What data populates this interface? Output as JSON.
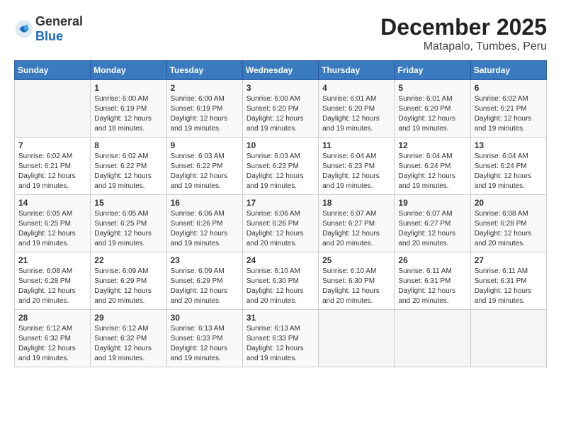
{
  "header": {
    "logo_general": "General",
    "logo_blue": "Blue",
    "title": "December 2025",
    "subtitle": "Matapalo, Tumbes, Peru"
  },
  "calendar": {
    "days_of_week": [
      "Sunday",
      "Monday",
      "Tuesday",
      "Wednesday",
      "Thursday",
      "Friday",
      "Saturday"
    ],
    "weeks": [
      [
        {
          "day": "",
          "info": ""
        },
        {
          "day": "1",
          "info": "Sunrise: 6:00 AM\nSunset: 6:19 PM\nDaylight: 12 hours\nand 18 minutes."
        },
        {
          "day": "2",
          "info": "Sunrise: 6:00 AM\nSunset: 6:19 PM\nDaylight: 12 hours\nand 19 minutes."
        },
        {
          "day": "3",
          "info": "Sunrise: 6:00 AM\nSunset: 6:20 PM\nDaylight: 12 hours\nand 19 minutes."
        },
        {
          "day": "4",
          "info": "Sunrise: 6:01 AM\nSunset: 6:20 PM\nDaylight: 12 hours\nand 19 minutes."
        },
        {
          "day": "5",
          "info": "Sunrise: 6:01 AM\nSunset: 6:20 PM\nDaylight: 12 hours\nand 19 minutes."
        },
        {
          "day": "6",
          "info": "Sunrise: 6:02 AM\nSunset: 6:21 PM\nDaylight: 12 hours\nand 19 minutes."
        }
      ],
      [
        {
          "day": "7",
          "info": "Sunrise: 6:02 AM\nSunset: 6:21 PM\nDaylight: 12 hours\nand 19 minutes."
        },
        {
          "day": "8",
          "info": "Sunrise: 6:02 AM\nSunset: 6:22 PM\nDaylight: 12 hours\nand 19 minutes."
        },
        {
          "day": "9",
          "info": "Sunrise: 6:03 AM\nSunset: 6:22 PM\nDaylight: 12 hours\nand 19 minutes."
        },
        {
          "day": "10",
          "info": "Sunrise: 6:03 AM\nSunset: 6:23 PM\nDaylight: 12 hours\nand 19 minutes."
        },
        {
          "day": "11",
          "info": "Sunrise: 6:04 AM\nSunset: 6:23 PM\nDaylight: 12 hours\nand 19 minutes."
        },
        {
          "day": "12",
          "info": "Sunrise: 6:04 AM\nSunset: 6:24 PM\nDaylight: 12 hours\nand 19 minutes."
        },
        {
          "day": "13",
          "info": "Sunrise: 6:04 AM\nSunset: 6:24 PM\nDaylight: 12 hours\nand 19 minutes."
        }
      ],
      [
        {
          "day": "14",
          "info": "Sunrise: 6:05 AM\nSunset: 6:25 PM\nDaylight: 12 hours\nand 19 minutes."
        },
        {
          "day": "15",
          "info": "Sunrise: 6:05 AM\nSunset: 6:25 PM\nDaylight: 12 hours\nand 19 minutes."
        },
        {
          "day": "16",
          "info": "Sunrise: 6:06 AM\nSunset: 6:26 PM\nDaylight: 12 hours\nand 19 minutes."
        },
        {
          "day": "17",
          "info": "Sunrise: 6:06 AM\nSunset: 6:26 PM\nDaylight: 12 hours\nand 20 minutes."
        },
        {
          "day": "18",
          "info": "Sunrise: 6:07 AM\nSunset: 6:27 PM\nDaylight: 12 hours\nand 20 minutes."
        },
        {
          "day": "19",
          "info": "Sunrise: 6:07 AM\nSunset: 6:27 PM\nDaylight: 12 hours\nand 20 minutes."
        },
        {
          "day": "20",
          "info": "Sunrise: 6:08 AM\nSunset: 6:28 PM\nDaylight: 12 hours\nand 20 minutes."
        }
      ],
      [
        {
          "day": "21",
          "info": "Sunrise: 6:08 AM\nSunset: 6:28 PM\nDaylight: 12 hours\nand 20 minutes."
        },
        {
          "day": "22",
          "info": "Sunrise: 6:09 AM\nSunset: 6:29 PM\nDaylight: 12 hours\nand 20 minutes."
        },
        {
          "day": "23",
          "info": "Sunrise: 6:09 AM\nSunset: 6:29 PM\nDaylight: 12 hours\nand 20 minutes."
        },
        {
          "day": "24",
          "info": "Sunrise: 6:10 AM\nSunset: 6:30 PM\nDaylight: 12 hours\nand 20 minutes."
        },
        {
          "day": "25",
          "info": "Sunrise: 6:10 AM\nSunset: 6:30 PM\nDaylight: 12 hours\nand 20 minutes."
        },
        {
          "day": "26",
          "info": "Sunrise: 6:11 AM\nSunset: 6:31 PM\nDaylight: 12 hours\nand 20 minutes."
        },
        {
          "day": "27",
          "info": "Sunrise: 6:11 AM\nSunset: 6:31 PM\nDaylight: 12 hours\nand 19 minutes."
        }
      ],
      [
        {
          "day": "28",
          "info": "Sunrise: 6:12 AM\nSunset: 6:32 PM\nDaylight: 12 hours\nand 19 minutes."
        },
        {
          "day": "29",
          "info": "Sunrise: 6:12 AM\nSunset: 6:32 PM\nDaylight: 12 hours\nand 19 minutes."
        },
        {
          "day": "30",
          "info": "Sunrise: 6:13 AM\nSunset: 6:33 PM\nDaylight: 12 hours\nand 19 minutes."
        },
        {
          "day": "31",
          "info": "Sunrise: 6:13 AM\nSunset: 6:33 PM\nDaylight: 12 hours\nand 19 minutes."
        },
        {
          "day": "",
          "info": ""
        },
        {
          "day": "",
          "info": ""
        },
        {
          "day": "",
          "info": ""
        }
      ]
    ]
  }
}
